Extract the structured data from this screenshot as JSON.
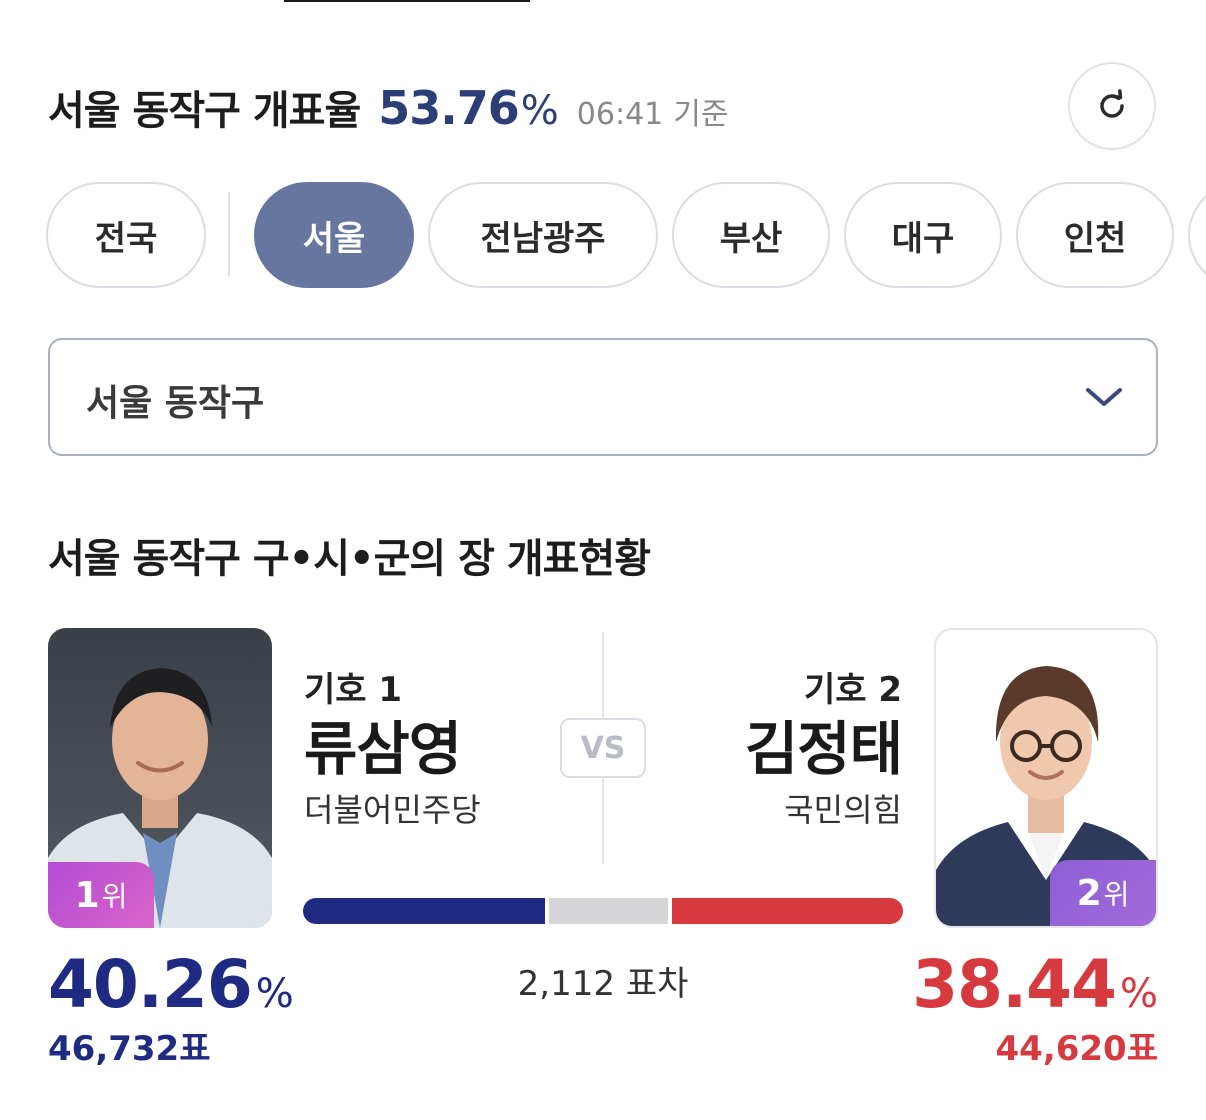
{
  "header": {
    "title": "서울 동작구 개표율",
    "rate": "53.76",
    "rate_unit": "%",
    "time": "06:41",
    "time_suffix": "기준"
  },
  "regions": [
    {
      "label": "전국",
      "active": false
    },
    {
      "label": "서울",
      "active": true
    },
    {
      "label": "전남광주",
      "active": false
    },
    {
      "label": "부산",
      "active": false
    },
    {
      "label": "대구",
      "active": false
    },
    {
      "label": "인천",
      "active": false
    }
  ],
  "dropdown": {
    "selected": "서울 동작구"
  },
  "section": {
    "title": "서울 동작구 구•시•군의 장 개표현황"
  },
  "vs_label": "VS",
  "candidates": [
    {
      "number": "기호 1",
      "name": "류삼영",
      "party": "더불어민주당",
      "rank": "1",
      "rank_unit": "위",
      "percent": "40.26",
      "percent_unit": "%",
      "votes": "46,732표",
      "color": "#1f2b82"
    },
    {
      "number": "기호 2",
      "name": "김정태",
      "party": "국민의힘",
      "rank": "2",
      "rank_unit": "위",
      "percent": "38.44",
      "percent_unit": "%",
      "votes": "44,620표",
      "color": "#d63a3f"
    }
  ],
  "vote_bar": {
    "left_share": 40.26,
    "right_share": 38.44,
    "neutral_color": "#d6d6d9"
  },
  "difference": "2,112 표차"
}
